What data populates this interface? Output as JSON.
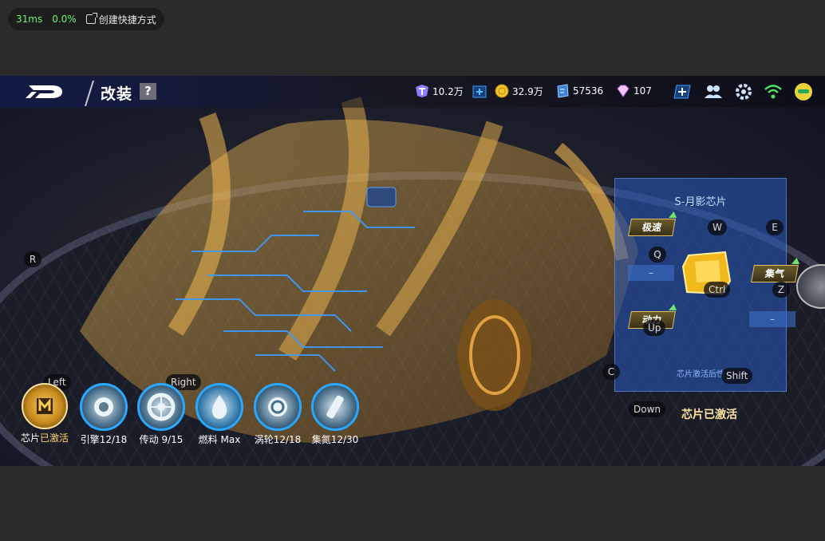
{
  "overlay": {
    "latency": "31ms",
    "loss": "0.0%",
    "shortcut_label": "创建快捷方式",
    "shortcut_icon": "external-link-icon"
  },
  "header": {
    "page_title": "改装",
    "help_label": "?",
    "resources": [
      {
        "icon": "ticket-icon",
        "value": "10.2万"
      },
      {
        "icon": "gold-coin-icon",
        "value": "32.9万"
      },
      {
        "icon": "blue-gem-icon",
        "value": "57536"
      },
      {
        "icon": "diamond-icon",
        "value": "107"
      }
    ]
  },
  "chip_panel": {
    "title": "S-月影芯片",
    "tags": {
      "speed": "极速",
      "nitro": "集气",
      "power": "动力"
    },
    "slot_dash": "–",
    "note": "芯片激活后性",
    "activated_label": "芯片已激活"
  },
  "key_hints": {
    "R": "R",
    "W": "W",
    "E": "E",
    "Q": "Q",
    "Ctrl": "Ctrl",
    "Z": "Z",
    "Up": "Up",
    "C": "C",
    "Shift": "Shift",
    "Down": "Down",
    "Left": "Left",
    "Right": "Right"
  },
  "nav": [
    {
      "label": "芯片",
      "value": "已激活",
      "icon": "chip-icon"
    },
    {
      "label": "引擎",
      "value": "12/18",
      "icon": "engine-icon"
    },
    {
      "label": "传动",
      "value": " 9/15",
      "icon": "wheel-icon"
    },
    {
      "label": "燃料",
      "value": " Max",
      "icon": "fuel-icon"
    },
    {
      "label": "涡轮",
      "value": "12/18",
      "icon": "turbo-icon"
    },
    {
      "label": "集氮",
      "value": "12/30",
      "icon": "nitro-icon"
    }
  ],
  "colors": {
    "accent_blue": "#2aa8ff",
    "gold": "#e8b040",
    "panel_blue": "#2a5ab8"
  }
}
